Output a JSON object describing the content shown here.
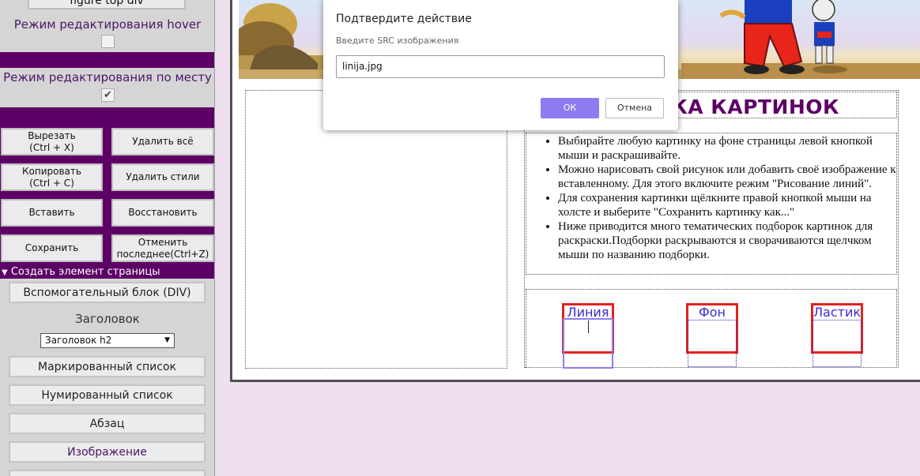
{
  "left_panel": {
    "top_button_label": "figure top div",
    "hover_mode_label": "Режим редактирования hover",
    "hover_mode_checked": false,
    "inplace_mode_label": "Режим редактирования по месту",
    "inplace_mode_checked": true,
    "check_mark": "✔",
    "actions": {
      "cut": "Вырезать\n(Ctrl + X)",
      "delete_all": "Удалить всё",
      "copy": "Копировать\n(Ctrl + C)",
      "delete_styles": "Удалить стили",
      "paste": "Вставить",
      "restore": "Восстановить",
      "save": "Сохранить",
      "undo": "Отменить\nпоследнее(Ctrl+Z)"
    },
    "create_section": {
      "toggle_icon": "▼",
      "title": "Создать элемент страницы",
      "helper_block": "Вспомогательный блок (DIV)",
      "heading_label": "Заголовок",
      "heading_select_value": "Заголовок h2",
      "select_arrow": "▼",
      "bulleted_list": "Маркированный список",
      "numbered_list": "Нумированный список",
      "paragraph": "Абзац",
      "image": "Изображение"
    }
  },
  "page": {
    "heading_visible": "СКА КАРТИНОК",
    "instructions": [
      "Выбирайте любую картинку на фоне страницы левой кнопкой мыши и раскрашивайте.",
      "Можно нарисовать свой рисунок или добавить своё изображение к вставленному. Для этого включите режим \"Рисование линий\".",
      "Для сохранения картинки щёлкните правой кнопкой мыши на холсте и выберите \"Сохранить картинку как...\"",
      "Ниже приводится много тематических подборок картинок для раскраски.Подборки раскрываются и сворачиваются щелчком мыши по названию подборки."
    ],
    "tools": [
      "Линия",
      "Фон",
      "Ластик"
    ]
  },
  "dialog": {
    "title": "Подтвердите действие",
    "prompt": "Введите SRC изображения",
    "input_value": "linija.jpg",
    "ok_label": "ОК",
    "cancel_label": "Отмена"
  },
  "colors": {
    "panel_purple": "#5d0066",
    "heading_purple": "#5d0066",
    "ok_button": "#8c7cf0",
    "tool_border": "#e0231f",
    "tool_text": "#3a2bd0",
    "page_background": "#efe0ef"
  }
}
